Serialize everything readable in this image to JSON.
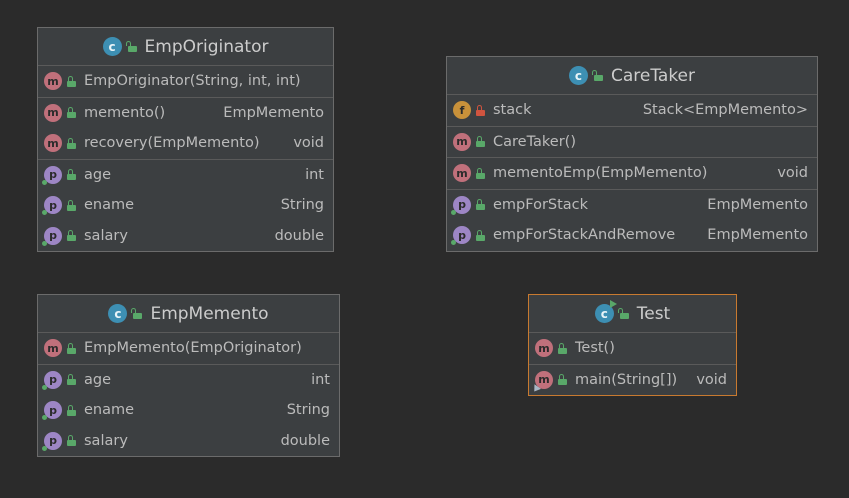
{
  "classes": {
    "emp_originator": {
      "title": "EmpOriginator",
      "methods_a": [
        {
          "name": "EmpOriginator(String, int, int)",
          "type": ""
        }
      ],
      "methods_b": [
        {
          "name": "memento()",
          "type": "EmpMemento"
        },
        {
          "name": "recovery(EmpMemento)",
          "type": "void"
        }
      ],
      "properties": [
        {
          "name": "age",
          "type": "int"
        },
        {
          "name": "ename",
          "type": "String"
        },
        {
          "name": "salary",
          "type": "double"
        }
      ]
    },
    "care_taker": {
      "title": "CareTaker",
      "fields": [
        {
          "name": "stack",
          "type": "Stack<EmpMemento>"
        }
      ],
      "constructors": [
        {
          "name": "CareTaker()",
          "type": ""
        }
      ],
      "methods": [
        {
          "name": "mementoEmp(EmpMemento)",
          "type": "void"
        }
      ],
      "properties": [
        {
          "name": "empForStack",
          "type": "EmpMemento"
        },
        {
          "name": "empForStackAndRemove",
          "type": "EmpMemento"
        }
      ]
    },
    "emp_memento": {
      "title": "EmpMemento",
      "constructors": [
        {
          "name": "EmpMemento(EmpOriginator)",
          "type": ""
        }
      ],
      "properties": [
        {
          "name": "age",
          "type": "int"
        },
        {
          "name": "ename",
          "type": "String"
        },
        {
          "name": "salary",
          "type": "double"
        }
      ]
    },
    "test": {
      "title": "Test",
      "constructors": [
        {
          "name": "Test()",
          "type": ""
        }
      ],
      "methods": [
        {
          "name": "main(String[])",
          "type": "void"
        }
      ]
    }
  },
  "badges": {
    "class": "c",
    "method": "m",
    "property": "p",
    "field": "f"
  },
  "colors": {
    "background": "#2b2b2b",
    "panel": "#3c3f41",
    "border": "#6b6b6b",
    "selected_border": "#c87a30",
    "method_badge": "#c0707b",
    "property_badge": "#9d86c5",
    "field_badge": "#c8913a",
    "class_badge": "#3d8fb3",
    "public_lock": "#59a869",
    "private_lock": "#d0543f"
  }
}
